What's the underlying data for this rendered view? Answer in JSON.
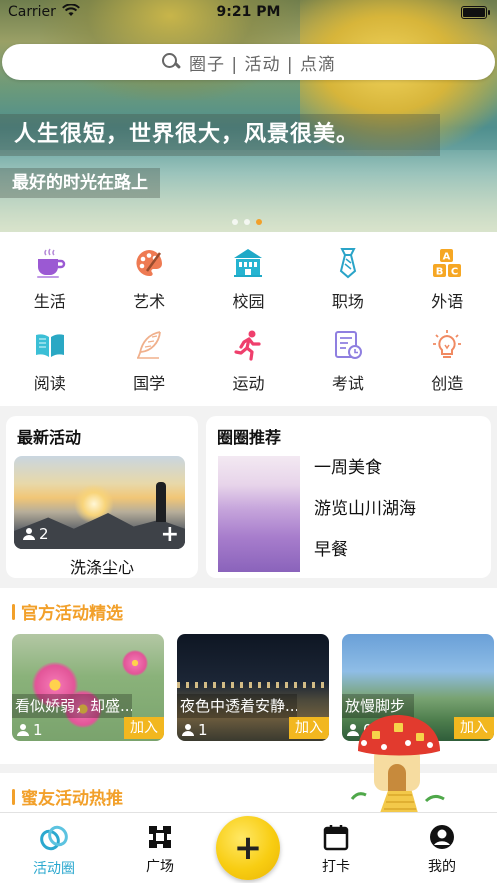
{
  "status_bar": {
    "carrier": "Carrier",
    "time": "9:21 PM"
  },
  "search": {
    "placeholder": "圈子 | 活动 | 点滴"
  },
  "banner": {
    "slogan_main": "人生很短，世界很大，风景很美。",
    "slogan_sub": "最好的时光在路上",
    "page_count": 3,
    "active_page": 3
  },
  "categories": [
    {
      "label": "生活",
      "icon": "coffee-cup-icon"
    },
    {
      "label": "艺术",
      "icon": "palette-icon"
    },
    {
      "label": "校园",
      "icon": "school-building-icon"
    },
    {
      "label": "职场",
      "icon": "necktie-icon"
    },
    {
      "label": "外语",
      "icon": "abc-blocks-icon"
    },
    {
      "label": "阅读",
      "icon": "open-book-icon"
    },
    {
      "label": "国学",
      "icon": "quill-feather-icon"
    },
    {
      "label": "运动",
      "icon": "runner-icon"
    },
    {
      "label": "考试",
      "icon": "exam-calendar-icon"
    },
    {
      "label": "创造",
      "icon": "lightbulb-icon"
    }
  ],
  "latest_activity": {
    "heading": "最新活动",
    "member_count": "2",
    "title": "洗涤尘心"
  },
  "circle_recommend": {
    "heading": "圈圈推荐",
    "items": [
      "一周美食",
      "游览山川湖海",
      "早餐"
    ]
  },
  "official": {
    "heading": "官方活动精选",
    "join_label": "加入",
    "activities": [
      {
        "title": "看似娇弱，却盛...",
        "count": "1"
      },
      {
        "title": "夜色中透着安静...",
        "count": "1"
      },
      {
        "title": "放慢脚步",
        "count": "0"
      }
    ]
  },
  "friends": {
    "heading": "蜜友活动热推"
  },
  "tabbar": {
    "tabs": [
      {
        "label": "活动圈",
        "icon": "rings-icon",
        "active": true
      },
      {
        "label": "广场",
        "icon": "square-frame-icon",
        "active": false
      },
      {
        "label": "打卡",
        "icon": "calendar-icon",
        "active": false
      },
      {
        "label": "我的",
        "icon": "user-profile-icon",
        "active": false
      }
    ],
    "fab_symbol": "+"
  },
  "colors": {
    "accent": "#f2a02a",
    "active_tab": "#2ba8cf",
    "join_button": "#f2b71f"
  }
}
